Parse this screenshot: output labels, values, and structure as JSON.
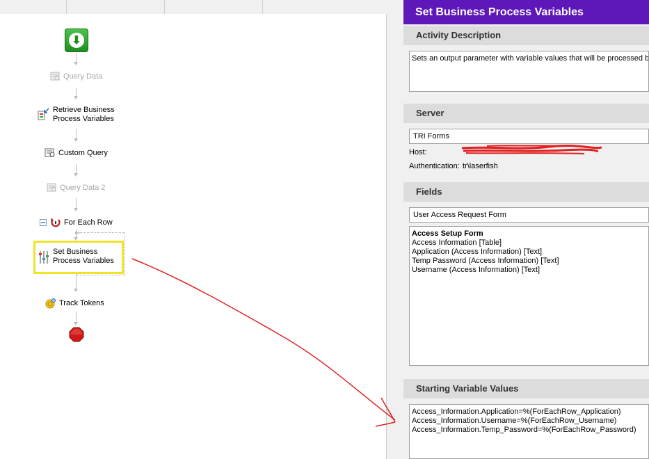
{
  "workflow": {
    "nodes": {
      "query_data": "Query Data",
      "retrieve_line1": "Retrieve Business",
      "retrieve_line2": "Process Variables",
      "custom_query": "Custom Query",
      "query_data_2": "Query Data 2",
      "for_each_row": "For Each Row",
      "set_line1": "Set Business",
      "set_line2": "Process Variables",
      "track_tokens": "Track Tokens"
    },
    "colors": {
      "selection": "#f1e32a",
      "start": "#1e8f1e",
      "stop": "#d01818",
      "annotation": "#e02020"
    }
  },
  "properties": {
    "title": "Set Business Process Variables",
    "activity_description": {
      "header": "Activity Description",
      "text": "Sets an output parameter with variable values that will be processed by L"
    },
    "server": {
      "header": "Server",
      "selected": "TRI Forms",
      "host_label": "Host:",
      "auth_label": "Authentication:",
      "auth_value": "tr\\laserfish"
    },
    "fields": {
      "header": "Fields",
      "selected_form": "User Access Request Form",
      "items": [
        "Access Setup Form",
        "Access Information [Table]",
        "Application (Access Information) [Text]",
        "Temp Password (Access Information) [Text]",
        "Username (Access Information) [Text]"
      ]
    },
    "starting_values": {
      "header": "Starting Variable Values",
      "lines": [
        "Access_Information.Application=%(ForEachRow_Application)",
        "Access_Information.Username=%(ForEachRow_Username)",
        "Access_Information.Temp_Password=%(ForEachRow_Password)"
      ]
    },
    "accent_color": "#5e17b8"
  }
}
